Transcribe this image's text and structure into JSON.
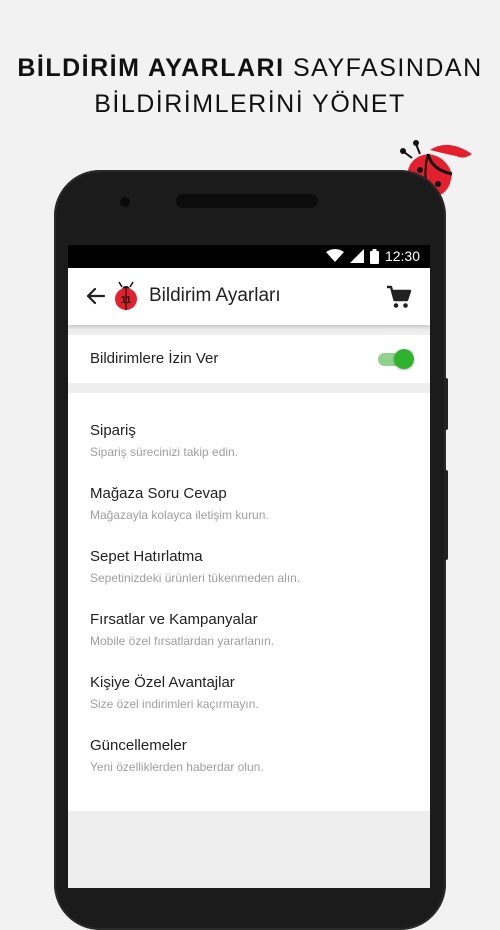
{
  "headline": {
    "bold": "BİLDİRİM AYARLARI",
    "rest": " SAYFASINDAN",
    "line2": "BİLDİRİMLERİNİ YÖNET"
  },
  "status_bar": {
    "time": "12:30"
  },
  "app_bar": {
    "title": "Bildirim Ayarları"
  },
  "toggle": {
    "label": "Bildirimlere İzin Ver",
    "enabled": true
  },
  "items": [
    {
      "title": "Sipariş",
      "subtitle": "Sipariş sürecinizi takip edin."
    },
    {
      "title": "Mağaza Soru Cevap",
      "subtitle": "Mağazayla kolayca iletişim kurun."
    },
    {
      "title": "Sepet Hatırlatma",
      "subtitle": "Sepetinizdeki ürünleri tükenmeden alın."
    },
    {
      "title": "Fırsatlar ve Kampanyalar",
      "subtitle": "Mobile özel fırsatlardan yararlanın."
    },
    {
      "title": "Kişiye Özel Avantajlar",
      "subtitle": "Size özel indirimleri kaçırmayın."
    },
    {
      "title": "Güncellemeler",
      "subtitle": "Yeni özelliklerden haberdar olun."
    }
  ],
  "colors": {
    "accent": "#e5202e",
    "switch_on": "#2fb32f"
  },
  "icons": [
    "back-arrow-icon",
    "ladybug-logo-icon",
    "cart-icon",
    "wifi-icon",
    "signal-icon",
    "battery-icon"
  ]
}
